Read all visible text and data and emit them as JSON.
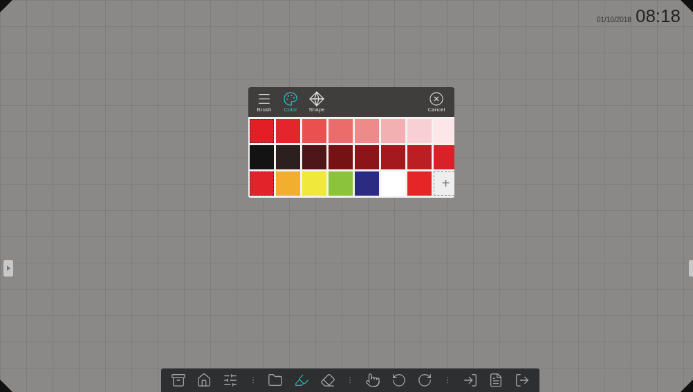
{
  "status": {
    "date": "01/10/2018",
    "time": "08:18"
  },
  "palette": {
    "tabs": [
      {
        "label": "Brush",
        "kind": "menu",
        "selected": false
      },
      {
        "label": "Color",
        "kind": "palette",
        "selected": true
      },
      {
        "label": "Shape",
        "kind": "shape",
        "selected": false
      }
    ],
    "cancel": {
      "label": "Cancel"
    },
    "swatches": [
      {
        "color": "#e31e24",
        "selected": true
      },
      {
        "color": "#e3262b",
        "selected": false
      },
      {
        "color": "#e9504f",
        "selected": false
      },
      {
        "color": "#ec6b6b",
        "selected": false
      },
      {
        "color": "#ee8a8a",
        "selected": false
      },
      {
        "color": "#f3b0b3",
        "selected": false
      },
      {
        "color": "#f8d0d3",
        "selected": false
      },
      {
        "color": "#fde6e7",
        "selected": false
      },
      {
        "color": "#131314",
        "selected": false
      },
      {
        "color": "#2c1f20",
        "selected": false
      },
      {
        "color": "#4f1619",
        "selected": false
      },
      {
        "color": "#761114",
        "selected": false
      },
      {
        "color": "#8c1519",
        "selected": false
      },
      {
        "color": "#a3191e",
        "selected": false
      },
      {
        "color": "#bb1e23",
        "selected": false
      },
      {
        "color": "#d62228",
        "selected": false
      },
      {
        "color": "#e2242a",
        "selected": true
      },
      {
        "color": "#f2ae2e",
        "selected": false
      },
      {
        "color": "#f0e83a",
        "selected": false
      },
      {
        "color": "#8cc33d",
        "selected": false
      },
      {
        "color": "#2c2b83",
        "selected": false
      },
      {
        "color": "#ffffff",
        "selected": false
      },
      {
        "color": "#e52526",
        "selected": false
      }
    ],
    "add_label": "+"
  },
  "toolbar": [
    {
      "kind": "drawer",
      "selected": false
    },
    {
      "kind": "home",
      "selected": false
    },
    {
      "kind": "sliders",
      "selected": false
    },
    {
      "kind": "separator"
    },
    {
      "kind": "folder",
      "selected": false
    },
    {
      "kind": "pen",
      "selected": true
    },
    {
      "kind": "eraser",
      "selected": false
    },
    {
      "kind": "separator"
    },
    {
      "kind": "hand",
      "selected": false
    },
    {
      "kind": "undo",
      "selected": false
    },
    {
      "kind": "redo",
      "selected": false
    },
    {
      "kind": "separator"
    },
    {
      "kind": "import",
      "selected": false
    },
    {
      "kind": "file",
      "selected": false
    },
    {
      "kind": "exit",
      "selected": false
    }
  ]
}
